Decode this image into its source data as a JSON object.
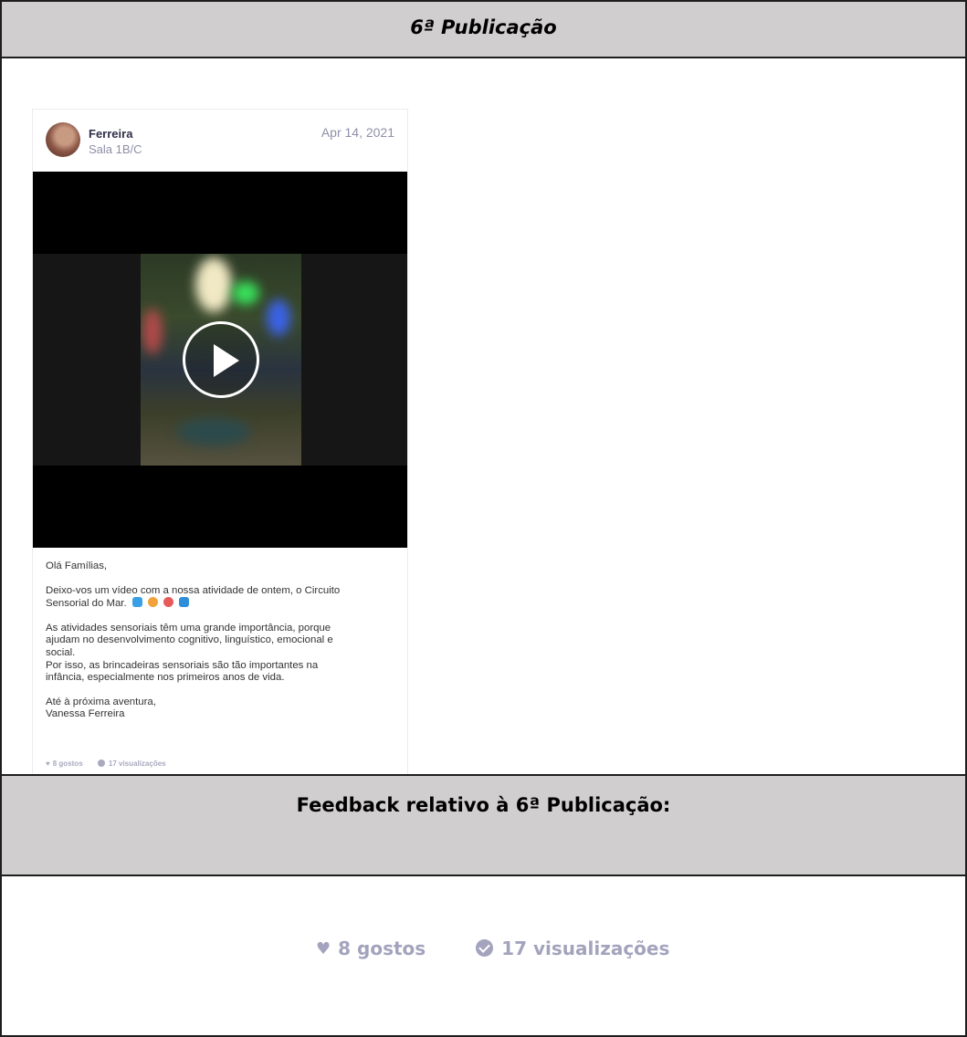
{
  "header": {
    "title": "6ª Publicação"
  },
  "post": {
    "author": "Ferreira",
    "room": "Sala 1B/C",
    "date": "Apr 14, 2021",
    "video": {
      "play_icon": "play-icon"
    },
    "text": {
      "greeting": "Olá Famílias,",
      "p1_line1": "Deixo-vos um vídeo com a nossa atividade de ontem, o Circuito",
      "p1_line2": "Sensorial do Mar.",
      "p2_line1": "As atividades sensoriais têm uma grande importância, porque",
      "p2_line2": "ajudam no desenvolvimento cognitivo, linguístico, emocional e",
      "p2_line3": "social.",
      "p2_line4": "Por isso, as brincadeiras sensoriais são tão importantes na",
      "p2_line5": "infância, especialmente nos primeiros anos de vida.",
      "closing_line1": "Até à próxima aventura,",
      "closing_line2": "Vanessa Ferreira"
    },
    "emojis": [
      "dolphin",
      "sun",
      "octopus",
      "wave"
    ],
    "stats": {
      "likes": "8 gostos",
      "views": "17 visualizações"
    }
  },
  "feedback": {
    "title": "Feedback relativo à 6ª Publicação:",
    "likes": "8 gostos",
    "views": "17 visualizações"
  },
  "colors": {
    "band": "#d0cece",
    "muted": "#a3a3bd",
    "author": "#2f2f48"
  }
}
